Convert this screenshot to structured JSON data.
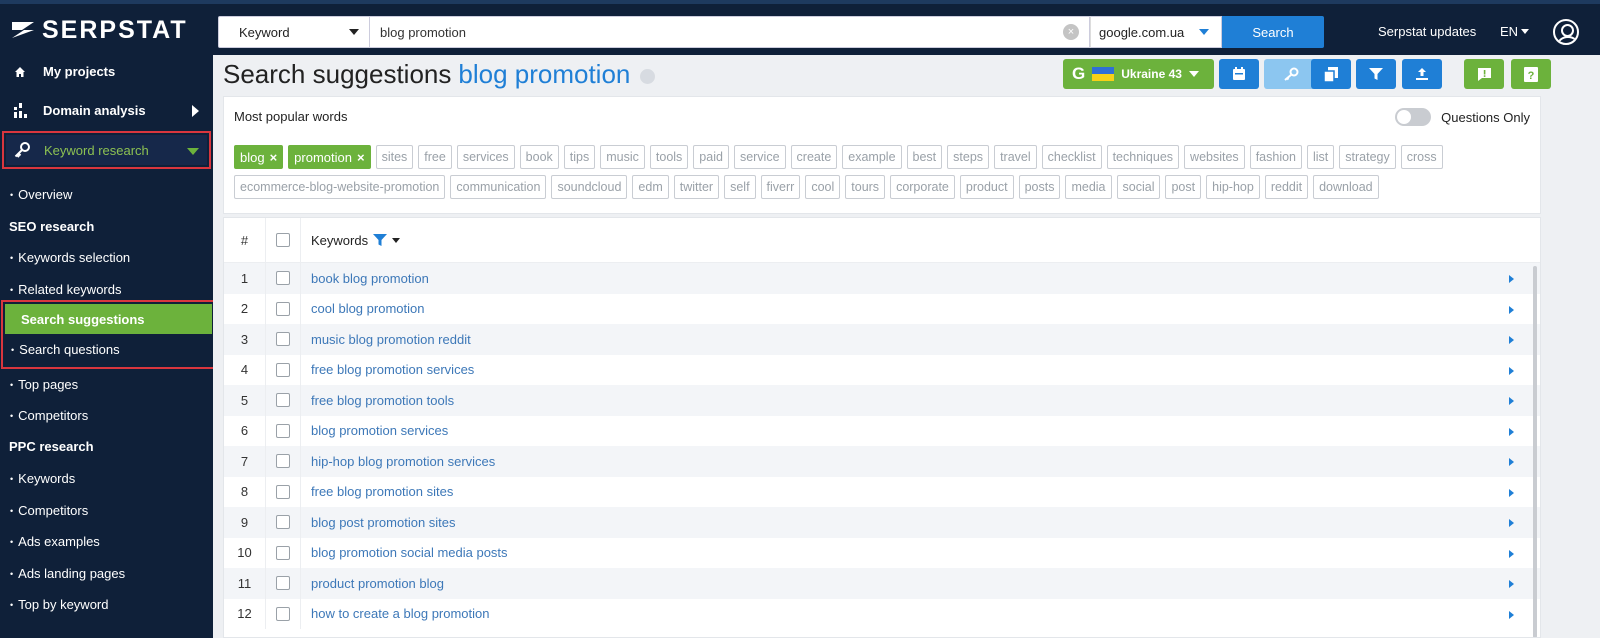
{
  "app": {
    "brand": "SERPSTAT"
  },
  "topbar": {
    "search_type": "Keyword",
    "query": "blog promotion",
    "engine": "google.com.ua",
    "search_label": "Search",
    "updates_link": "Serpstat updates",
    "lang": "EN"
  },
  "sidebar": {
    "my_projects": "My projects",
    "domain_analysis": "Domain analysis",
    "keyword_research": "Keyword research",
    "overview": "Overview",
    "seo_section": "SEO research",
    "keywords_selection": "Keywords selection",
    "related_keywords": "Related keywords",
    "search_suggestions": "Search suggestions",
    "search_questions": "Search questions",
    "top_pages": "Top pages",
    "competitors": "Competitors",
    "ppc_section": "PPC research",
    "ppc_keywords": "Keywords",
    "ppc_competitors": "Competitors",
    "ads_examples": "Ads examples",
    "ads_landing_pages": "Ads landing pages",
    "top_by_keyword": "Top by keyword"
  },
  "header": {
    "title": "Search suggestions",
    "query": "blog promotion",
    "region_label": "Ukraine 43",
    "colors": {
      "accent": "#1f7fd6",
      "green": "#6cb23c",
      "sidebar": "#0f2039",
      "link": "#3d78b8"
    }
  },
  "popular_words": {
    "title": "Most popular words",
    "questions_only": "Questions Only",
    "selected": [
      "blog",
      "promotion"
    ],
    "words": [
      "sites",
      "free",
      "services",
      "book",
      "tips",
      "music",
      "tools",
      "paid",
      "service",
      "create",
      "example",
      "best",
      "steps",
      "travel",
      "checklist",
      "techniques",
      "websites",
      "fashion",
      "list",
      "strategy",
      "cross",
      "ecommerce-blog-website-promotion",
      "communication",
      "soundcloud",
      "edm",
      "twitter",
      "self",
      "fiverr",
      "cool",
      "tours",
      "corporate",
      "product",
      "posts",
      "media",
      "social",
      "post",
      "hip-hop",
      "reddit",
      "download"
    ]
  },
  "table": {
    "col_num": "#",
    "col_keywords": "Keywords",
    "rows": [
      {
        "n": "1",
        "kw": "book blog promotion"
      },
      {
        "n": "2",
        "kw": "cool blog promotion"
      },
      {
        "n": "3",
        "kw": "music blog promotion reddit"
      },
      {
        "n": "4",
        "kw": "free blog promotion services"
      },
      {
        "n": "5",
        "kw": "free blog promotion tools"
      },
      {
        "n": "6",
        "kw": "blog promotion services"
      },
      {
        "n": "7",
        "kw": "hip-hop blog promotion services"
      },
      {
        "n": "8",
        "kw": "free blog promotion sites"
      },
      {
        "n": "9",
        "kw": "blog post promotion sites"
      },
      {
        "n": "10",
        "kw": "blog promotion social media posts"
      },
      {
        "n": "11",
        "kw": "product promotion blog"
      },
      {
        "n": "12",
        "kw": "how to create a blog promotion"
      }
    ]
  }
}
